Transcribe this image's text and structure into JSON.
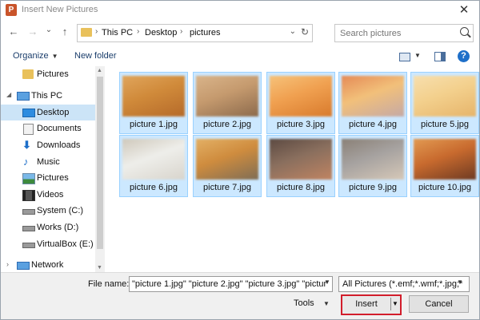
{
  "window": {
    "title": "Insert New Pictures",
    "app_icon_letter": "P",
    "close_glyph": "✕"
  },
  "nav_buttons": {
    "back": "←",
    "forward": "→",
    "recent": "⌄",
    "up": "↑"
  },
  "address": {
    "crumbs": [
      "This PC",
      "Desktop",
      "pictures"
    ],
    "dropdown_glyph": "⌄",
    "refresh_glyph": "↻"
  },
  "search": {
    "placeholder": "Search pictures"
  },
  "toolbar": {
    "organize": "Organize",
    "new_folder": "New folder",
    "help": "?"
  },
  "nav_pane": {
    "items": [
      {
        "label": "Pictures",
        "icon": "folder-icon",
        "selected": false
      },
      {
        "label": "This PC",
        "icon": "computer-icon",
        "selected": false
      },
      {
        "label": "Desktop",
        "icon": "desktop-icon",
        "selected": true
      },
      {
        "label": "Documents",
        "icon": "documents-icon",
        "selected": false
      },
      {
        "label": "Downloads",
        "icon": "downloads-icon",
        "selected": false
      },
      {
        "label": "Music",
        "icon": "music-icon",
        "selected": false
      },
      {
        "label": "Pictures",
        "icon": "pictures-icon",
        "selected": false
      },
      {
        "label": "Videos",
        "icon": "videos-icon",
        "selected": false
      },
      {
        "label": "System (C:)",
        "icon": "drive-icon",
        "selected": false
      },
      {
        "label": "Works (D:)",
        "icon": "drive-icon",
        "selected": false
      },
      {
        "label": "VirtualBox (E:)",
        "icon": "drive-icon",
        "selected": false
      },
      {
        "label": "Network",
        "icon": "network-icon",
        "selected": false
      }
    ]
  },
  "files": [
    {
      "name": "picture 1.jpg",
      "colors": [
        "#d08a3a",
        "#b56a2a",
        "#e0a55c"
      ]
    },
    {
      "name": "picture 2.jpg",
      "colors": [
        "#c59a6e",
        "#8c6a4c",
        "#d9b48a"
      ]
    },
    {
      "name": "picture 3.jpg",
      "colors": [
        "#f0a050",
        "#d87a2c",
        "#f6c27a"
      ]
    },
    {
      "name": "picture 4.jpg",
      "colors": [
        "#f2c07a",
        "#c5a9a6",
        "#e58a56"
      ]
    },
    {
      "name": "picture 5.jpg",
      "colors": [
        "#f3d08d",
        "#e6b46a",
        "#f7dfae"
      ]
    },
    {
      "name": "picture 6.jpg",
      "colors": [
        "#eeeeea",
        "#d8d4cc",
        "#cfc8bb"
      ]
    },
    {
      "name": "picture 7.jpg",
      "colors": [
        "#cf8c3e",
        "#7f6d55",
        "#e3b065"
      ]
    },
    {
      "name": "picture 8.jpg",
      "colors": [
        "#8a6f5e",
        "#c08462",
        "#5c4a42"
      ]
    },
    {
      "name": "picture 9.jpg",
      "colors": [
        "#a6a2a0",
        "#d6c8b8",
        "#8a8076"
      ]
    },
    {
      "name": "picture 10.jpg",
      "colors": [
        "#c86a2e",
        "#6e3a22",
        "#e29a52"
      ]
    }
  ],
  "bottom": {
    "file_name_label": "File name:",
    "file_name_value": "\"picture 1.jpg\" \"picture 2.jpg\" \"picture 3.jpg\" \"pictur",
    "filter_value": "All Pictures (*.emf;*.wmf;*.jpg;*",
    "tools_label": "Tools",
    "insert_label": "Insert",
    "cancel_label": "Cancel"
  },
  "colors": {
    "selection": "#cce8ff",
    "accent_red": "#d21d2b",
    "nav_selected": "#cce4f7"
  }
}
